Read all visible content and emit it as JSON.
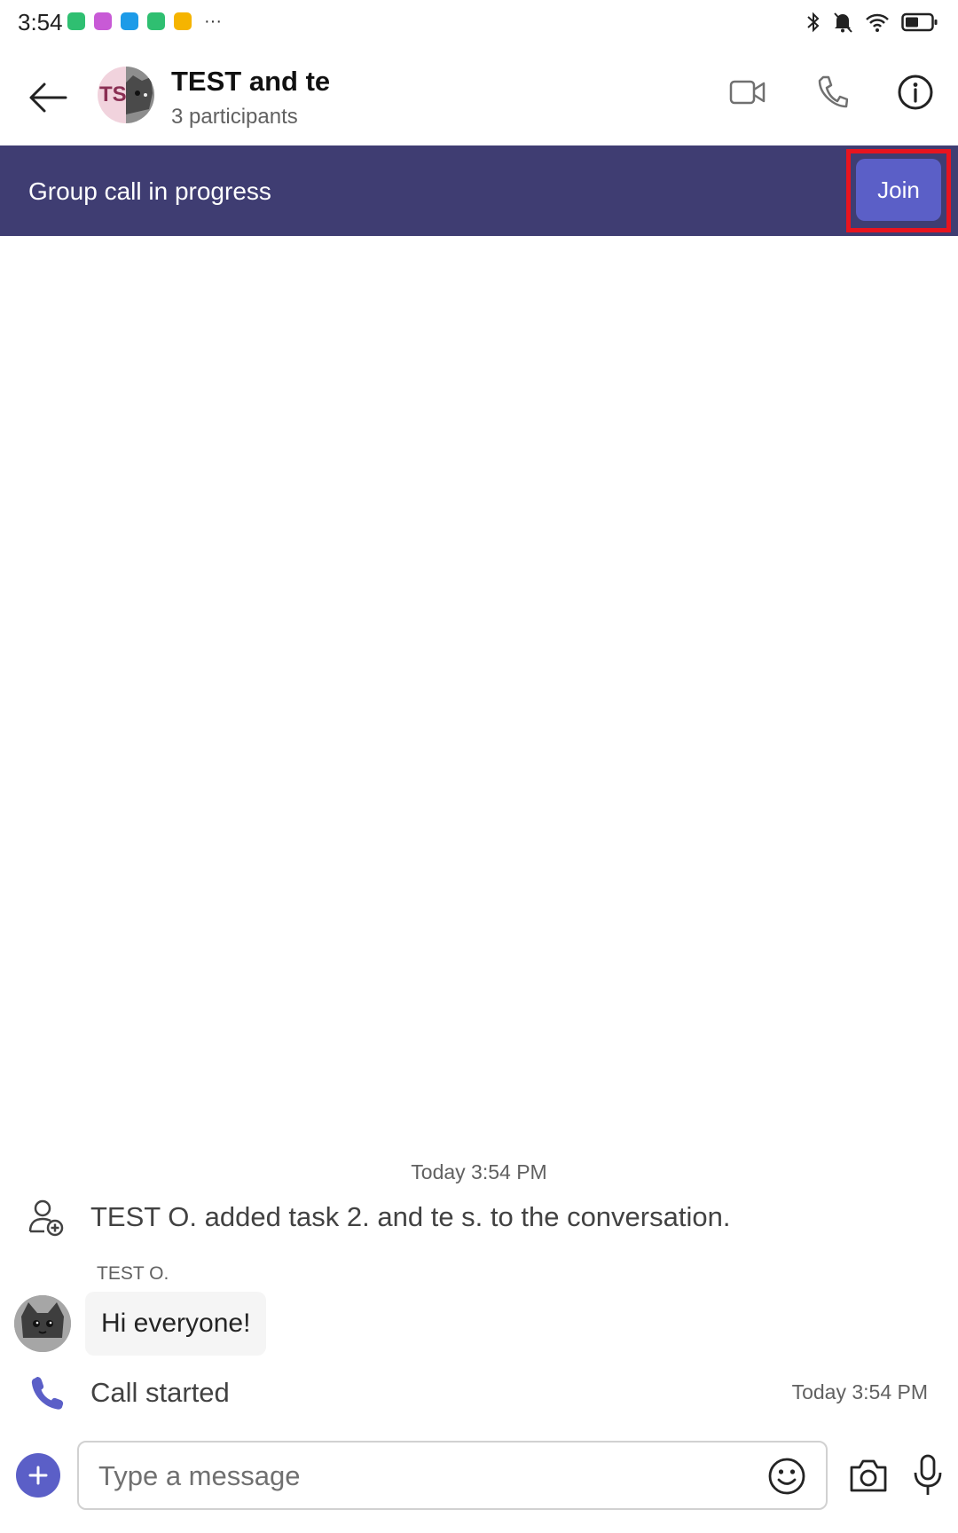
{
  "status_bar": {
    "time": "3:54",
    "more": "···",
    "notification_icon_colors": [
      "#2fbf71",
      "#c85ad6",
      "#1d9be8",
      "#2fbf71",
      "#f5b400"
    ]
  },
  "header": {
    "title": "TEST and te",
    "subtitle": "3 participants",
    "avatar_initials": "TS"
  },
  "call_banner": {
    "text": "Group call in progress",
    "join_label": "Join"
  },
  "conversation": {
    "timestamp": "Today 3:54 PM",
    "system_message": "TEST O. added task 2. and te s. to the conversation.",
    "sender_name": "TEST O.",
    "message_text": "Hi everyone!",
    "call_event_text": "Call started",
    "call_event_time": "Today 3:54 PM"
  },
  "composer": {
    "placeholder": "Type a message"
  },
  "colors": {
    "accent": "#5b5fc7",
    "banner": "#3f3d72",
    "highlight": "#e8141f"
  }
}
